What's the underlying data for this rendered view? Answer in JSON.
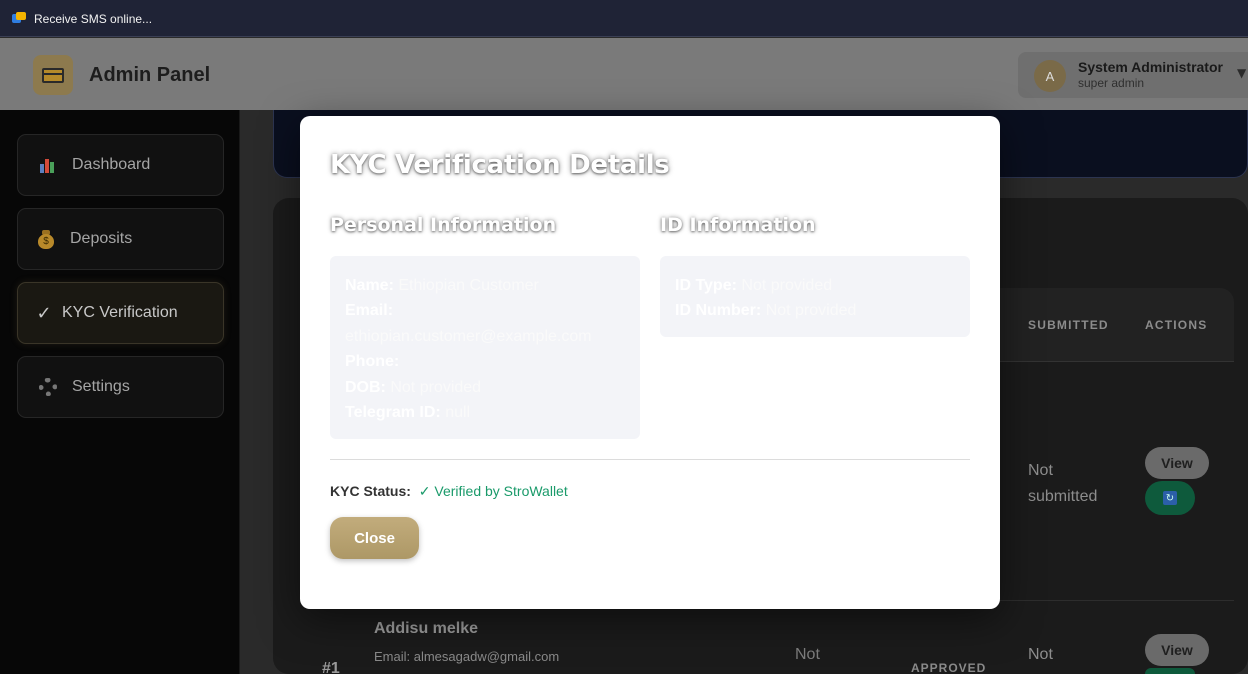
{
  "browser": {
    "tab_title": "Receive SMS online..."
  },
  "header": {
    "title": "Admin Panel",
    "user": {
      "initial": "A",
      "name": "System Administrator",
      "role": "super admin",
      "caret": "▼"
    }
  },
  "sidebar": {
    "items": [
      {
        "label": "Dashboard",
        "icon": "bar-chart-icon"
      },
      {
        "label": "Deposits",
        "icon": "money-bag-icon"
      },
      {
        "label": "KYC Verification",
        "icon": "check-icon",
        "active": true
      },
      {
        "label": "Settings",
        "icon": "gear-icon"
      }
    ]
  },
  "table": {
    "columns": {
      "submitted": "SUBMITTED",
      "actions": "ACTIONS"
    },
    "rows": [
      {
        "submitted": "Not submitted",
        "view_label": "View",
        "sync_icon": "sync-icon"
      },
      {
        "index": "#1",
        "name": "Addisu melke",
        "email": "Email: almesagadw@gmail.com",
        "col_not": "Not",
        "status": "APPROVED",
        "submitted": "Not",
        "view_label": "View"
      }
    ]
  },
  "modal": {
    "title": "KYC Verification Details",
    "personal": {
      "heading": "Personal Information",
      "name_label": "Name:",
      "name_value": "Ethiopian Customer",
      "email_label": "Email:",
      "email_value": "ethiopian.customer@example.com",
      "phone_label": "Phone:",
      "phone_value": "",
      "dob_label": "DOB:",
      "dob_value": "Not provided",
      "telegram_label": "Telegram ID:",
      "telegram_value": "null"
    },
    "id_info": {
      "heading": "ID Information",
      "type_label": "ID Type:",
      "type_value": "Not provided",
      "number_label": "ID Number:",
      "number_value": "Not provided"
    },
    "status_label": "KYC Status:",
    "status_value": "✓ Verified by StroWallet",
    "close_label": "Close"
  },
  "colors": {
    "accent_gold": "#b8a06e",
    "verified_green": "#1a9a6a",
    "overlay": "rgba(0,0,0,0.5)"
  }
}
